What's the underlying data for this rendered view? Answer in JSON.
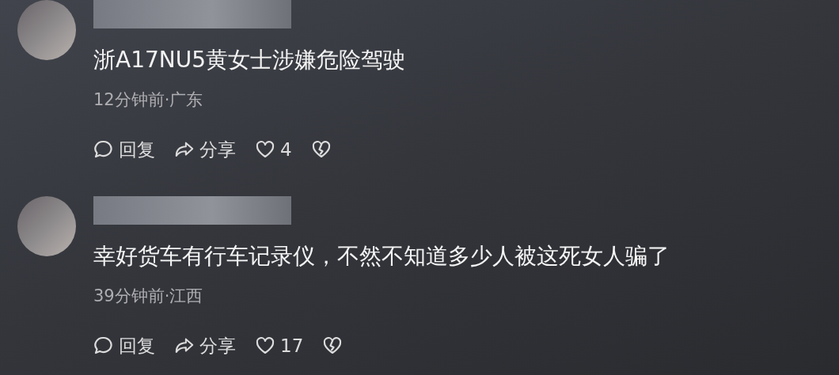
{
  "comments": [
    {
      "text": "浙A17NU5黄女士涉嫌危险驾驶",
      "meta": "12分钟前·广东",
      "reply": "回复",
      "share": "分享",
      "likes": "4"
    },
    {
      "text": "幸好货车有行车记录仪，不然不知道多少人被这死女人骗了",
      "meta": "39分钟前·江西",
      "reply": "回复",
      "share": "分享",
      "likes": "17"
    }
  ]
}
